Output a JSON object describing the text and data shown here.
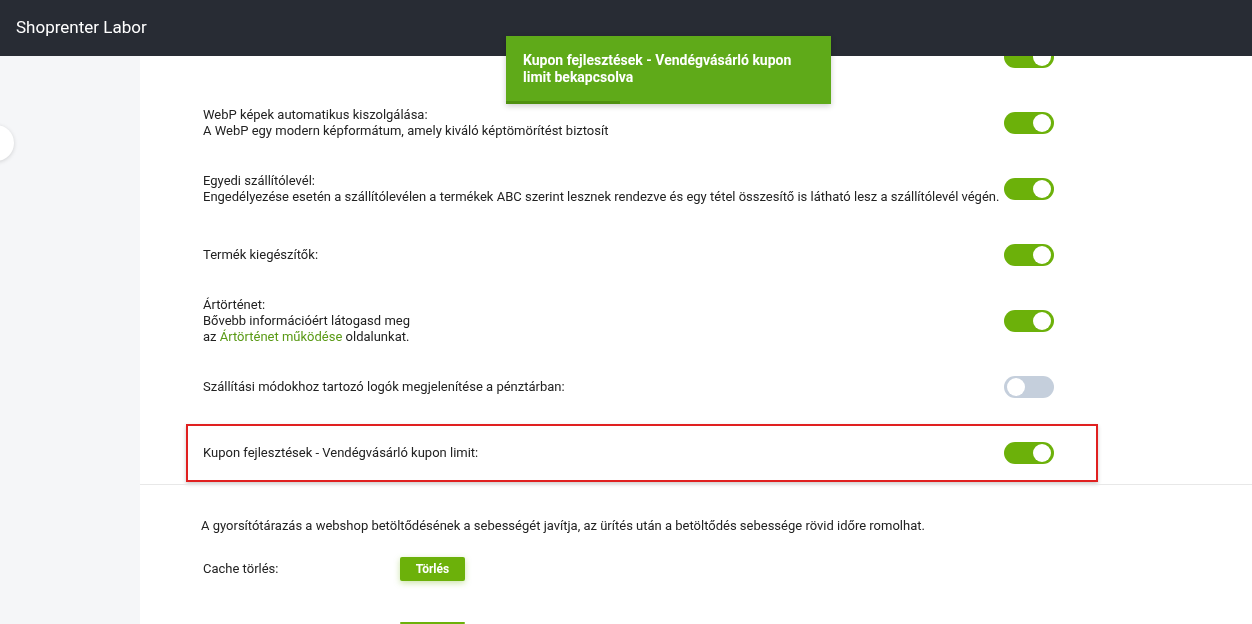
{
  "header": {
    "title": "Shoprenter Labor"
  },
  "toast": {
    "text": "Kupon fejlesztések - Vendégvásárló kupon limit bekapcsolva",
    "level": 0.35
  },
  "settings": [
    {
      "on": true,
      "highlighted": false
    },
    {
      "title": "WebP képek automatikus kiszolgálása:",
      "description": "A WebP egy modern képformátum, amely kiváló képtömörítést biztosít",
      "on": true,
      "highlighted": false
    },
    {
      "title": "Egyedi szállítólevél:",
      "description": "Engedélyezése esetén a szállítólevélen a termékek ABC szerint lesznek rendezve és egy tétel összesítő is látható lesz a szállítólevél végén.",
      "on": true,
      "highlighted": false
    },
    {
      "title": "Termék kiegészítők:",
      "on": true,
      "highlighted": false
    },
    {
      "title": "Ártörténet:",
      "description": "Bővebb információért látogasd meg",
      "link_prefix": "az",
      "link": "Ártörténet működése",
      "link_suffix": "oldalunkat.",
      "on": true,
      "highlighted": false
    },
    {
      "title": "Szállítási módokhoz tartozó logók megjelenítése a pénztárban:",
      "on": false,
      "highlighted": false
    },
    {
      "title": "Kupon fejlesztések - Vendégvásárló kupon limit:",
      "on": true,
      "highlighted": true
    }
  ],
  "cache": {
    "note": "A gyorsítótárazás a webshop betöltődésének a sebességét javítja, az ürítés után a betöltődés sebessége rövid időre romolhat.",
    "label": "Cache törlés:",
    "button": "Törlés"
  }
}
